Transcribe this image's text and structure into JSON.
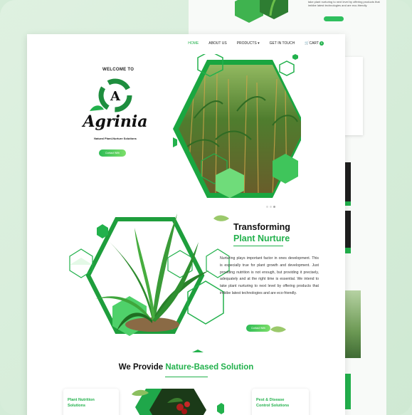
{
  "background": {
    "top_text": "take plant nurturing to next level by offering products that imbibe latest technologies and are eco-friendly."
  },
  "nav": {
    "home": "HOME",
    "about": "ABOUT US",
    "products": "PRODUCTS",
    "contact": "GET IN TOUCH",
    "cart": "CART",
    "cart_count": "0"
  },
  "hero": {
    "welcome": "WELCOME TO",
    "brand": "Agrinia",
    "tagline": "Natural Plant-Nurture Solutions",
    "cta": "Contact With"
  },
  "about": {
    "title_line1": "Transforming",
    "title_line2": "Plant Nurture",
    "paragraph": "Nurturing plays important factor in ones development. This is especially true for plant growth and development. Just providing nutrition is not enough, but providing it precisely, adequately and at the right time is essential. We intend to take plant nurturing to next level by offering products that imbibe latest technologies and are eco-friendly.",
    "cta": "Contact With"
  },
  "solutions": {
    "title_prefix": "We Provide",
    "title_highlight": "Nature-Based Solution",
    "cards": [
      {
        "title": "Plant Nutrition Solutions"
      },
      {
        "title": "Pest & Disease Control Solutions"
      }
    ]
  },
  "colors": {
    "accent": "#22b14c",
    "accent_light": "#7ddf6a",
    "text": "#111111"
  }
}
